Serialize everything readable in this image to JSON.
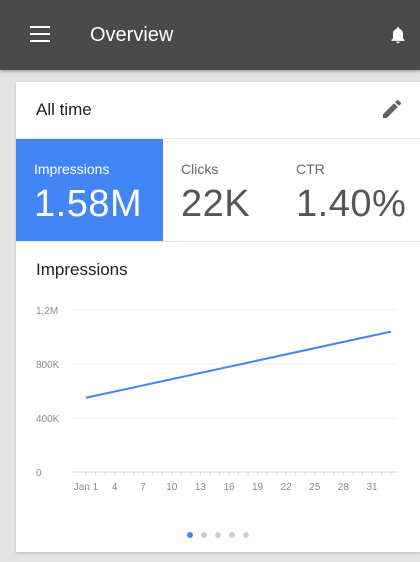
{
  "appbar": {
    "title": "Overview",
    "menu_icon": "menu-icon",
    "bell_icon": "notifications-icon"
  },
  "period": {
    "label": "All time",
    "edit_icon": "edit-pencil-icon"
  },
  "metrics": [
    {
      "label": "Impressions",
      "value": "1.58M",
      "active": true
    },
    {
      "label": "Clicks",
      "value": "22K",
      "active": false
    },
    {
      "label": "CTR",
      "value": "1.40%",
      "active": false
    }
  ],
  "colors": {
    "accent": "#4285f4",
    "appbar": "#4a4a4a",
    "background": "#e3e3e3"
  },
  "pager": {
    "count": 5,
    "active_index": 0
  },
  "chart_data": {
    "type": "line",
    "title": "Impressions",
    "xlabel": "",
    "ylabel": "",
    "x_ticks": [
      "Jan 1",
      "4",
      "7",
      "10",
      "13",
      "16",
      "19",
      "22",
      "25",
      "28",
      "31"
    ],
    "y_ticks": [
      "0",
      "400K",
      "800K",
      "1,2M"
    ],
    "ylim": [
      0,
      1200000
    ],
    "x": [
      1,
      33
    ],
    "series": [
      {
        "values": [
          550000,
          1040000
        ],
        "color": "#4285f4"
      }
    ],
    "grid": true,
    "legend": "none"
  }
}
